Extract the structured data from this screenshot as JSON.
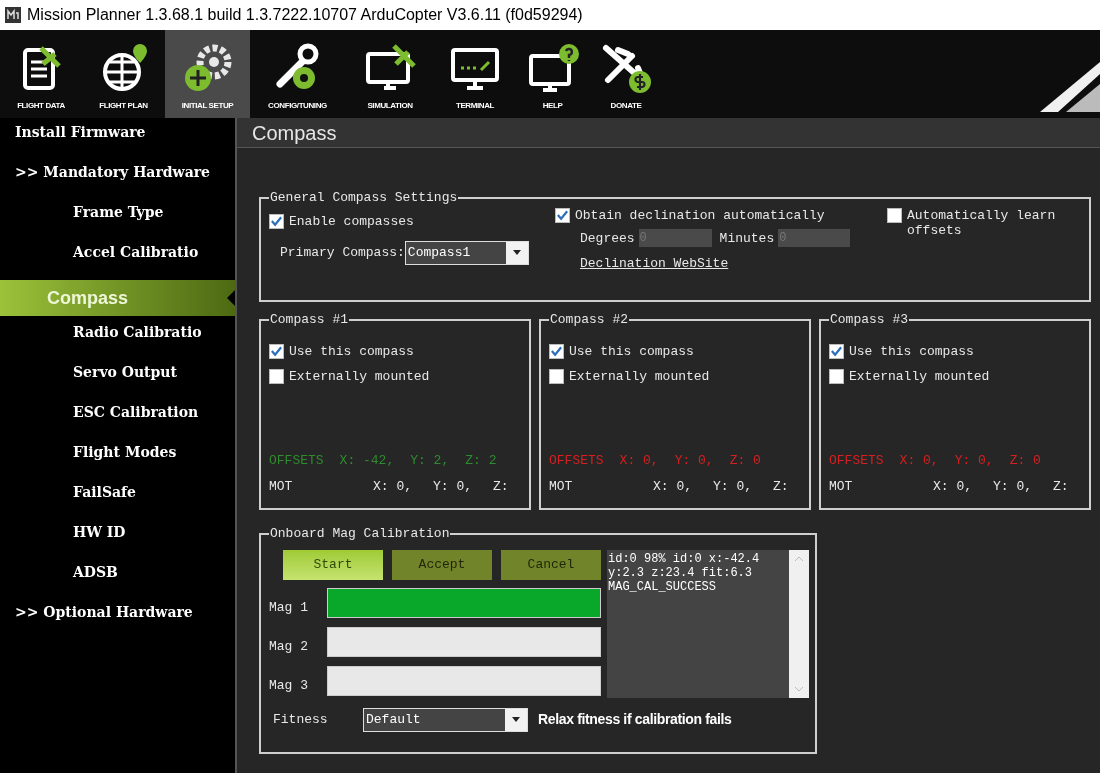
{
  "window": {
    "title": "Mission Planner 1.3.68.1 build 1.3.7222.10707 ArduCopter V3.6.11 (f0d59294)"
  },
  "toolbar": [
    {
      "label": "FLIGHT DATA",
      "kind": "data",
      "selected": false
    },
    {
      "label": "FLIGHT PLAN",
      "kind": "plan",
      "selected": false
    },
    {
      "label": "INITIAL SETUP",
      "kind": "setup",
      "selected": true
    },
    {
      "label": "CONFIG/TUNING",
      "kind": "config",
      "selected": false
    },
    {
      "label": "SIMULATION",
      "kind": "simulation",
      "selected": false
    },
    {
      "label": "TERMINAL",
      "kind": "terminal",
      "selected": false
    },
    {
      "label": "HELP",
      "kind": "help",
      "selected": false
    },
    {
      "label": "DONATE",
      "kind": "donate",
      "selected": false
    }
  ],
  "sidebar": {
    "items": [
      {
        "label": "Install Firmware",
        "selected": false
      },
      {
        "label": ">> Mandatory Hardware",
        "selected": false,
        "children": [
          {
            "label": "Frame Type",
            "selected": false
          },
          {
            "label": "Accel Calibratio",
            "selected": false
          },
          {
            "label": "Compass",
            "selected": true
          },
          {
            "label": "Radio Calibratio",
            "selected": false
          },
          {
            "label": "Servo Output",
            "selected": false
          },
          {
            "label": "ESC Calibration",
            "selected": false
          },
          {
            "label": "Flight Modes",
            "selected": false
          },
          {
            "label": "FailSafe",
            "selected": false
          },
          {
            "label": "HW ID",
            "selected": false
          },
          {
            "label": "ADSB",
            "selected": false
          }
        ]
      },
      {
        "label": ">> Optional Hardware",
        "selected": false
      }
    ]
  },
  "page_title": "Compass",
  "general": {
    "title": "General Compass Settings",
    "enable": {
      "label": "Enable compasses",
      "checked": true
    },
    "primary_label": "Primary Compass:",
    "primary_value": "Compass1",
    "declination": {
      "label": "Obtain declination automatically",
      "checked": true
    },
    "learn": {
      "label": "Automatically learn offsets",
      "checked": false
    },
    "degrees_label": "Degrees",
    "degrees_value": "0",
    "minutes_label": "Minutes",
    "minutes_value": "0",
    "link": "Declination WebSite"
  },
  "compasses": [
    {
      "title": "Compass #1",
      "use": {
        "label": "Use this compass",
        "checked": true
      },
      "external": {
        "label": "Externally mounted",
        "checked": false
      },
      "color": "#2e8b2e",
      "offsets": [
        "OFFSETS",
        "X: -42,",
        "Y: 2,",
        "Z: 2"
      ],
      "mot": [
        "MOT",
        "X: 0,",
        "Y: 0,",
        "Z:"
      ]
    },
    {
      "title": "Compass #2",
      "use": {
        "label": "Use this compass",
        "checked": true
      },
      "external": {
        "label": "Externally mounted",
        "checked": false
      },
      "color": "#d42020",
      "offsets": [
        "OFFSETS",
        "X: 0,",
        "Y: 0,",
        "Z: 0"
      ],
      "mot": [
        "MOT",
        "X: 0,",
        "Y: 0,",
        "Z:"
      ]
    },
    {
      "title": "Compass #3",
      "use": {
        "label": "Use this compass",
        "checked": true
      },
      "external": {
        "label": "Externally mounted",
        "checked": false
      },
      "color": "#d42020",
      "offsets": [
        "OFFSETS",
        "X: 0,",
        "Y: 0,",
        "Z: 0"
      ],
      "mot": [
        "MOT",
        "X: 0,",
        "Y: 0,",
        "Z:"
      ]
    }
  ],
  "calibration": {
    "title": "Onboard Mag Calibration",
    "buttons": [
      {
        "label": "Start",
        "disabled": false
      },
      {
        "label": "Accept",
        "disabled": true
      },
      {
        "label": "Cancel",
        "disabled": true
      }
    ],
    "mags": [
      {
        "label": "Mag 1",
        "level": 1
      },
      {
        "label": "Mag 2",
        "level": 0
      },
      {
        "label": "Mag 3",
        "level": 0
      }
    ],
    "log": [
      "id:0 98% id:0 x:-42.4",
      "y:2.3 z:23.4 fit:6.3",
      "MAG_CAL_SUCCESS"
    ],
    "fitness_label": "Fitness",
    "fitness_value": "Default",
    "relax_label": "Relax fitness if calibration fails"
  }
}
